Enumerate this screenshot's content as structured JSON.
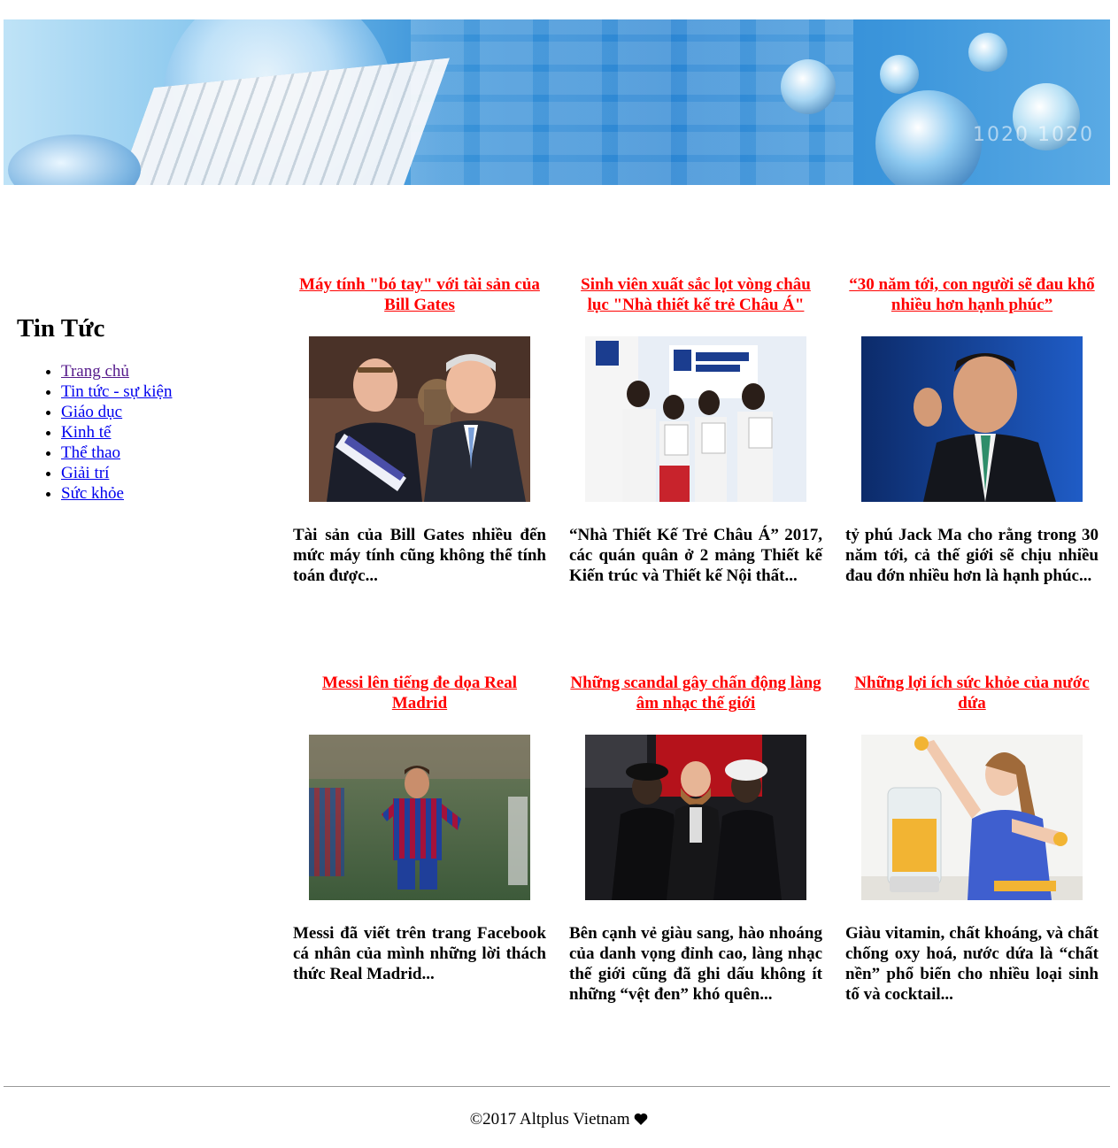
{
  "sidebar": {
    "title": "Tin Tức",
    "items": [
      {
        "label": "Trang chủ"
      },
      {
        "label": "Tin tức - sự kiện"
      },
      {
        "label": "Giáo dục"
      },
      {
        "label": "Kinh tế"
      },
      {
        "label": "Thể thao"
      },
      {
        "label": "Giải trí"
      },
      {
        "label": "Sức khỏe"
      }
    ]
  },
  "articles": [
    {
      "title": "Máy tính \"bó tay\" với tài sản của Bill Gates",
      "desc": "Tài sản của Bill Gates nhiều đến mức máy tính cũng không thể tính toán được..."
    },
    {
      "title": "Sinh viên xuất sắc lọt vòng châu lục \"Nhà thiết kế trẻ Châu Á\"",
      "desc": "“Nhà Thiết Kế Trẻ Châu Á” 2017, các quán quân ở 2 mảng Thiết kế Kiến trúc và Thiết kế Nội thất..."
    },
    {
      "title": "“30 năm tới, con người sẽ đau khổ nhiều hơn hạnh phúc”",
      "desc": "tỷ phú Jack Ma cho rằng trong 30 năm tới, cả thế giới sẽ chịu nhiều đau đớn nhiều hơn là hạnh phúc..."
    },
    {
      "title": "Messi lên tiếng đe dọa Real Madrid",
      "desc": "Messi đã viết trên trang Facebook cá nhân của mình những lời thách thức Real Madrid..."
    },
    {
      "title": "Những scandal gây chấn động làng âm nhạc thế giới",
      "desc": "Bên cạnh vẻ giàu sang, hào nhoáng của danh vọng đỉnh cao, làng nhạc thế giới cũng đã ghi dấu không ít những “vệt đen” khó quên..."
    },
    {
      "title": "Những lợi ích sức khỏe của nước dứa",
      "desc": "Giàu vitamin, chất khoáng, và chất chống oxy hoá, nước dứa là “chất nền” phổ biến cho nhiều loại sinh tố và cocktail..."
    }
  ],
  "banner": {
    "decor_text": "1020 1020"
  },
  "footer": {
    "text": "©2017 Altplus Vietnam",
    "icon": "heart-icon"
  },
  "colors": {
    "title_link": "#ff0000",
    "nav_link": "#0000ee",
    "nav_link_visited": "#551a8b"
  }
}
